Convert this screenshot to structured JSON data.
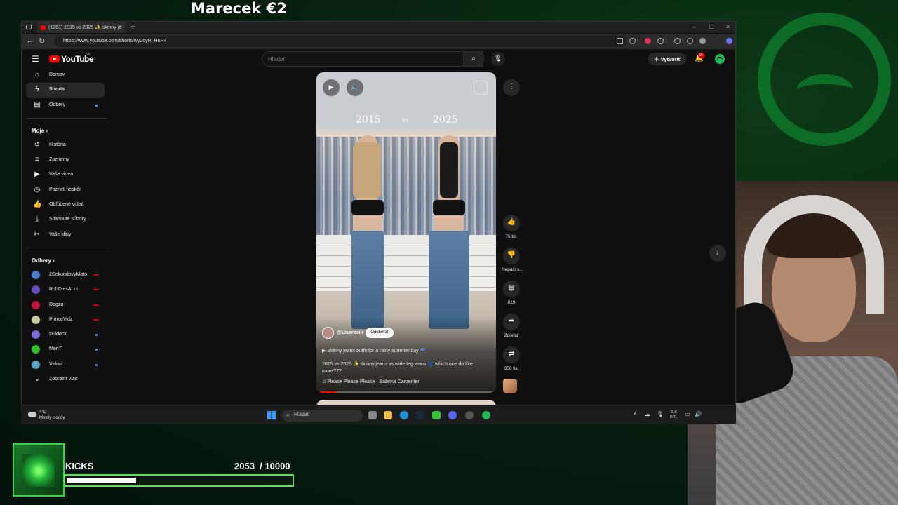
{
  "overlay": {
    "stream_title": "Marecek €2",
    "kicks": {
      "label": "KICKS",
      "current": "2053",
      "total": "/ 10000",
      "progress_fraction": 0.2053
    }
  },
  "browser": {
    "tab_title": "(1261) 2015 vs 2025 ✨ skinny je",
    "tab_close": "×",
    "new_tab": "+",
    "url": "https://www.youtube.com/shorts/wy25yR_H6R4",
    "window_controls": [
      "–",
      "□",
      "×"
    ]
  },
  "youtube": {
    "logo_text": "YouTube",
    "logo_region": "SK",
    "search_placeholder": "Hľadať",
    "create_label": "Vytvoriť",
    "notification_badge": "9+",
    "sidebar": {
      "main": [
        {
          "label": "Domov",
          "icon": "home-icon"
        },
        {
          "label": "Shorts",
          "icon": "shorts-icon",
          "active": true
        },
        {
          "label": "Odbery",
          "icon": "subscriptions-icon",
          "dot": true
        }
      ],
      "you_header": "Moje",
      "you": [
        {
          "label": "História",
          "icon": "history-icon"
        },
        {
          "label": "Zoznamy",
          "icon": "playlists-icon"
        },
        {
          "label": "Vaše videá",
          "icon": "your-videos-icon"
        },
        {
          "label": "Pozrieť neskôr",
          "icon": "watch-later-icon"
        },
        {
          "label": "Obľúbené videá",
          "icon": "liked-icon"
        },
        {
          "label": "Stiahnuté súbory",
          "icon": "downloads-icon"
        },
        {
          "label": "Vaše klipy",
          "icon": "clips-icon"
        }
      ],
      "subs_header": "Odbery",
      "subs": [
        {
          "label": "2SekundovyMato",
          "color": "#4a7bd0",
          "status": "live"
        },
        {
          "label": "RobDiesALot",
          "color": "#6b4cc0",
          "status": "live"
        },
        {
          "label": "Dogzu",
          "color": "#c0143c",
          "status": "live"
        },
        {
          "label": "PrinceVidz",
          "color": "#c8c8a0",
          "status": "live"
        },
        {
          "label": "Duklock",
          "color": "#7a6ad8",
          "status": "dot"
        },
        {
          "label": "MenT",
          "color": "#2fbf2f",
          "status": "dot"
        },
        {
          "label": "Vidrail",
          "color": "#5aa0c8",
          "status": "dot"
        }
      ],
      "show_more": "Zobraziť viac"
    },
    "short": {
      "overlay_year_left": "2015",
      "overlay_vs": "vs",
      "overlay_year_right": "2025",
      "channel": "@Lisarosiii",
      "subscribe_label": "Odoberať",
      "playlist_line": "▶  Skinny jeans outfit for a rainy summer day ☔",
      "title": "2015 vs 2025 ✨ skinny jeans vs wide leg jeans 👖 which one do like more???",
      "sound": "♫ Please Please Please · Sabrina Carpenter",
      "progress_fraction": 0.11
    },
    "actions": {
      "like_count": "76 tis.",
      "dislike_label": "Nepáči s...",
      "comments_count": "819",
      "share_label": "Zdieľať",
      "remix_count": "356 tis."
    }
  },
  "taskbar": {
    "temperature": "4°C",
    "weather": "Mostly cloudy",
    "search_label": "Hľadať",
    "lang_top": "SLK",
    "lang_bottom": "INTL"
  },
  "colors": {
    "accent_red": "#ff0000",
    "stream_green": "#0f9a34",
    "kicks_border": "#5ce15c"
  }
}
